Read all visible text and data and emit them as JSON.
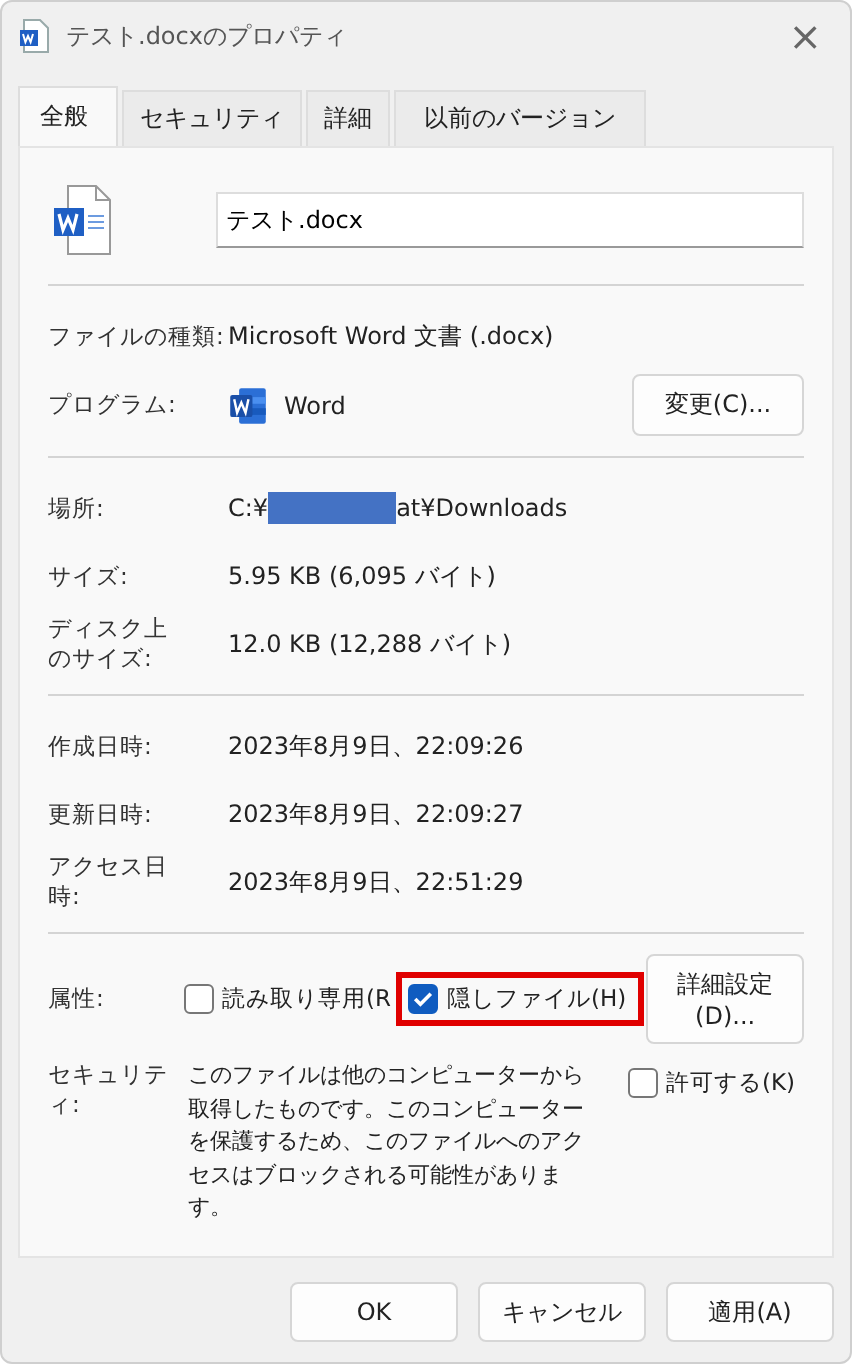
{
  "window": {
    "title": "テスト.docxのプロパティ",
    "close": "×"
  },
  "tabs": [
    {
      "label": "全般",
      "selected": true
    },
    {
      "label": "セキュリティ",
      "selected": false
    },
    {
      "label": "詳細",
      "selected": false
    },
    {
      "label": "以前のバージョン",
      "selected": false
    }
  ],
  "file_name": {
    "value": "テスト.docx"
  },
  "sections": [
    [
      {
        "kind": "text",
        "label": "ファイルの種類:",
        "value": "Microsoft Word 文書 (.docx)"
      },
      {
        "kind": "program",
        "label": "プログラム:",
        "value": "Word",
        "button": "変更(C)..."
      }
    ],
    [
      {
        "kind": "path",
        "label": "場所:",
        "prefix": "C:¥",
        "suffix": "at¥Downloads"
      },
      {
        "kind": "text",
        "label": "サイズ:",
        "value": "5.95 KB (6,095 バイト)"
      },
      {
        "kind": "text",
        "label": "ディスク上のサイズ:",
        "value": "12.0 KB (12,288 バイト)"
      }
    ],
    [
      {
        "kind": "text",
        "label": "作成日時:",
        "value": "2023年8月9日、22:09:26"
      },
      {
        "kind": "text",
        "label": "更新日時:",
        "value": "2023年8月9日、22:09:27"
      },
      {
        "kind": "text",
        "label": "アクセス日時:",
        "value": "2023年8月9日、22:51:29"
      }
    ],
    [
      {
        "kind": "attributes",
        "label": "属性:",
        "button": "詳細設定(D)...",
        "checkboxes": [
          {
            "label": "読み取り専用(R",
            "checked": false,
            "highlighted": false
          },
          {
            "label": "隠しファイル(H)",
            "checked": true,
            "highlighted": true
          }
        ]
      },
      {
        "kind": "security",
        "label": "セキュリティ:",
        "text": "このファイルは他のコンピューターから取得したものです。このコンピューターを保護するため、このファイルへのアクセスはブロックされる可能性があります。",
        "checkbox": {
          "label": "許可する(K)",
          "checked": false
        }
      }
    ]
  ],
  "buttons": [
    "OK",
    "キャンセル",
    "適用(A)"
  ]
}
